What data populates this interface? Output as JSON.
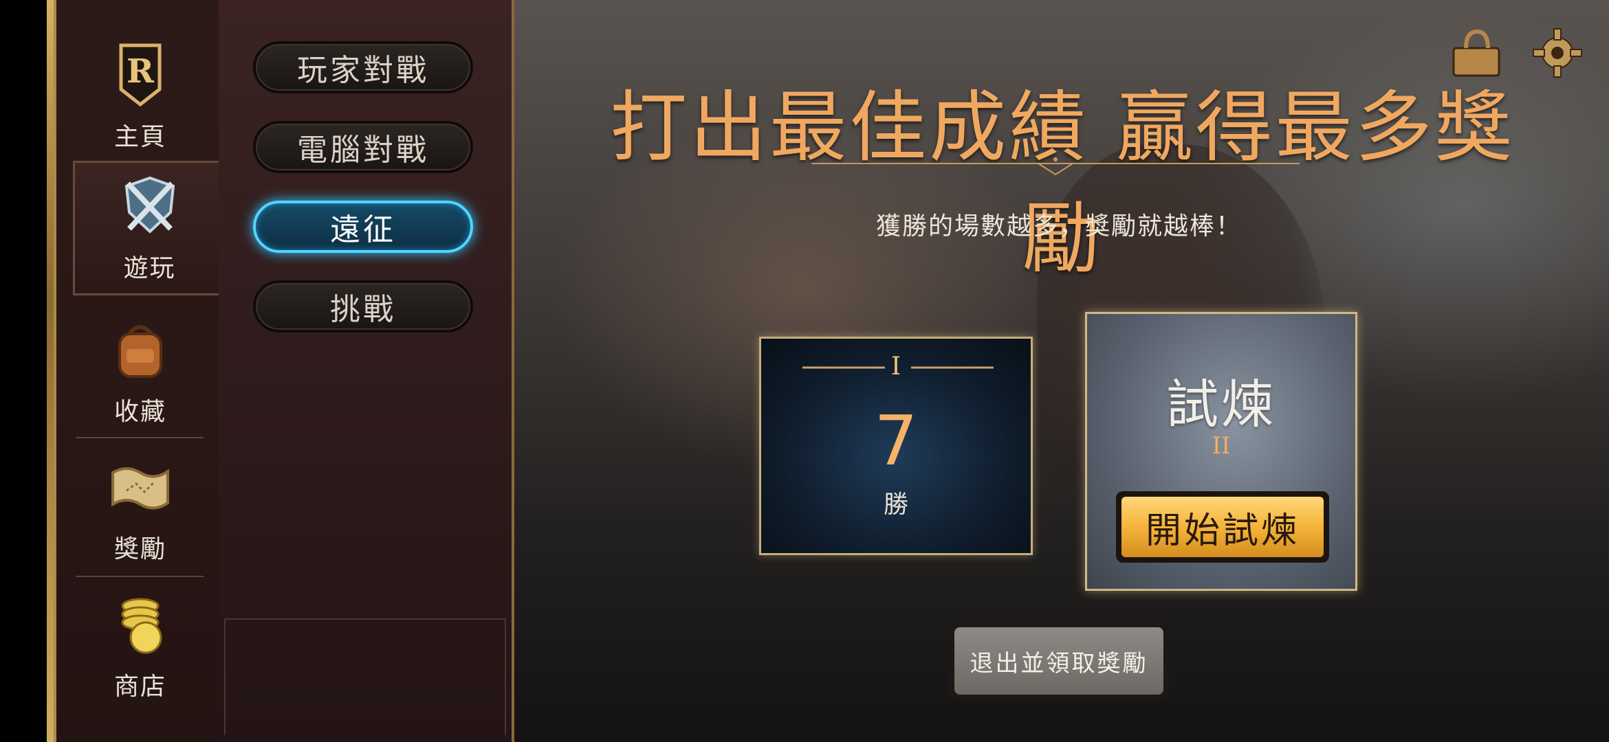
{
  "nav": {
    "items": [
      {
        "label": "主頁",
        "icon": "legends-logo-icon"
      },
      {
        "label": "遊玩",
        "icon": "crossed-swords-shield-icon",
        "active": true
      },
      {
        "label": "收藏",
        "icon": "backpack-icon"
      },
      {
        "label": "獎勵",
        "icon": "treasure-map-icon"
      },
      {
        "label": "商店",
        "icon": "coins-icon"
      }
    ]
  },
  "modes": {
    "items": [
      {
        "label": "玩家對戰"
      },
      {
        "label": "電腦對戰"
      },
      {
        "label": "遠征",
        "active": true
      },
      {
        "label": "挑戰"
      }
    ]
  },
  "main": {
    "headline": "打出最佳成績 贏得最多獎勵",
    "subtitle": "獲勝的場數越多，獎勵就越棒！",
    "wins_card": {
      "tier": "I",
      "count": "7",
      "label": "勝"
    },
    "trial_card": {
      "title": "試煉",
      "tier": "II",
      "button": "開始試煉"
    },
    "exit_button": "退出並領取獎勵"
  },
  "top_icons": [
    "shop-bag-icon",
    "gear-icon"
  ],
  "colors": {
    "headline": "#f0a860",
    "active_mode_glow": "#53d4ff",
    "gold_button": "#f4b43a"
  }
}
